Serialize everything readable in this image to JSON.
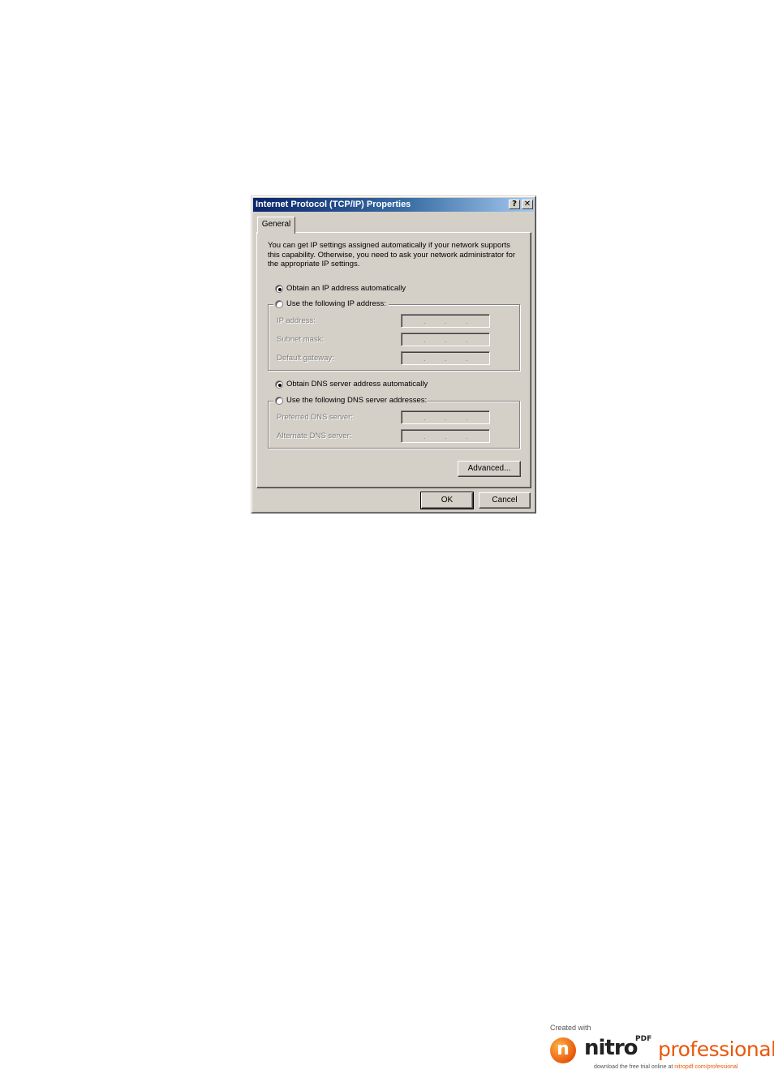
{
  "dialog": {
    "title": "Internet Protocol (TCP/IP) Properties",
    "help_label": "?",
    "close_label": "✕",
    "tab_label": "General",
    "description": "You can get IP settings assigned automatically if your network supports this capability. Otherwise, you need to ask your network administrator for the appropriate IP settings.",
    "ip": {
      "auto_label": "Obtain an IP address automatically",
      "auto_checked": true,
      "manual_label": "Use the following IP address:",
      "fields": [
        {
          "label": "IP address:"
        },
        {
          "label": "Subnet mask:"
        },
        {
          "label": "Default gateway:"
        }
      ]
    },
    "dns": {
      "auto_label": "Obtain DNS server address automatically",
      "auto_checked": true,
      "manual_label": "Use the following DNS server addresses:",
      "fields": [
        {
          "label": "Preferred DNS server:"
        },
        {
          "label": "Alternate DNS server:"
        }
      ]
    },
    "advanced_label": "Advanced...",
    "ok_label": "OK",
    "cancel_label": "Cancel"
  },
  "watermark": {
    "created_with": "Created with",
    "brand_n": "n",
    "brand_nitro": "nitro",
    "brand_pdf": "PDF",
    "brand_professional": "professional",
    "download_text": "download the free trial online at ",
    "download_link": "nitropdf.com/professional"
  }
}
